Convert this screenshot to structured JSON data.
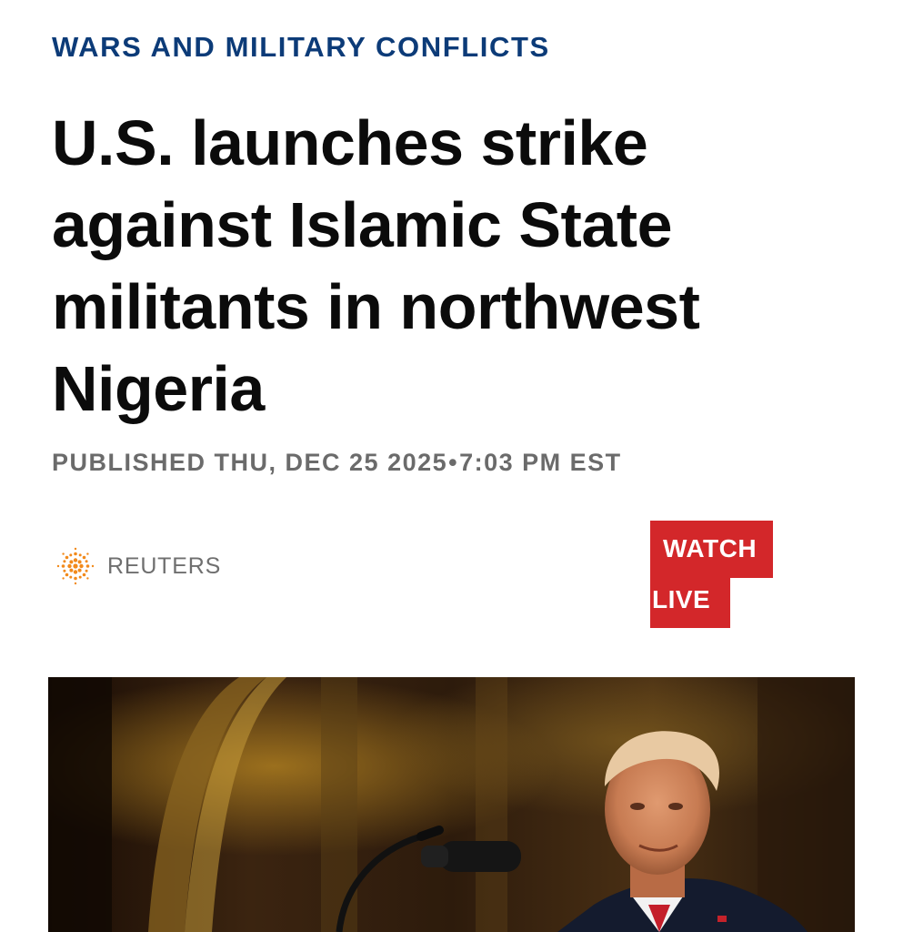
{
  "article": {
    "category": "WARS AND MILITARY CONFLICTS",
    "headline": "U.S. launches strike against Islamic State militants in northwest Nigeria",
    "published_label": "PUBLISHED",
    "published_date": "THU, DEC 25 2025",
    "published_separator": "•",
    "published_time": "7:03 PM EST",
    "source": "REUTERS"
  },
  "watch_live": {
    "line1": "WATCH",
    "line2": "LIVE"
  },
  "colors": {
    "category": "#0c3b78",
    "headline": "#0b0b0b",
    "meta": "#6b6b6b",
    "watch_live": "#d3272a",
    "reuters_logo": "#f28a1b"
  },
  "icons": {
    "source_logo": "reuters-logo-icon"
  }
}
